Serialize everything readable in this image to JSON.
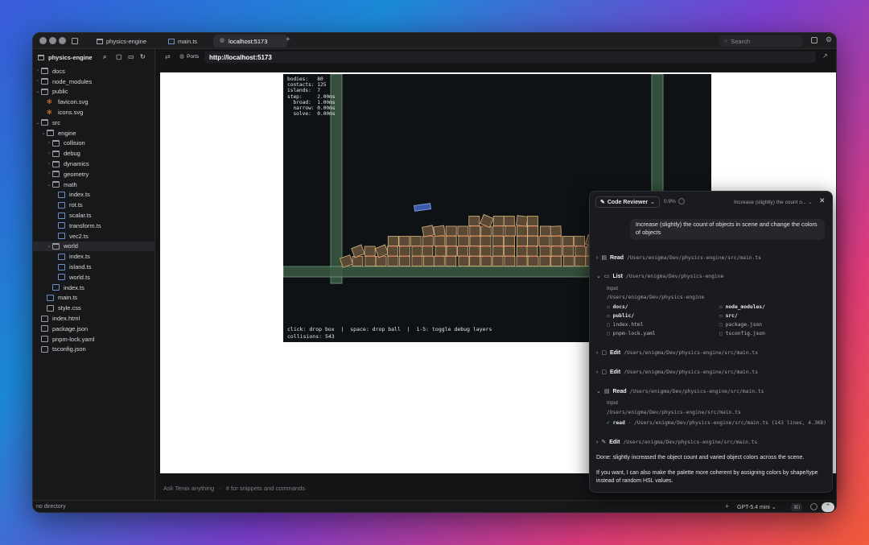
{
  "window": {
    "tabs": [
      {
        "label": "physics-engine"
      },
      {
        "label": "main.ts"
      },
      {
        "label": "localhost:5173"
      }
    ],
    "new_tab": "+",
    "search_placeholder": "Search"
  },
  "sidebar": {
    "project": "physics-engine",
    "tree": [
      {
        "label": "docs",
        "depth": 0,
        "kind": "dir",
        "open": false
      },
      {
        "label": "node_modules",
        "depth": 0,
        "kind": "dir",
        "open": false
      },
      {
        "label": "public",
        "depth": 0,
        "kind": "dir",
        "open": true
      },
      {
        "label": "favicon.svg",
        "depth": 1,
        "kind": "svg"
      },
      {
        "label": "icons.svg",
        "depth": 1,
        "kind": "svg"
      },
      {
        "label": "src",
        "depth": 0,
        "kind": "dir",
        "open": true
      },
      {
        "label": "engine",
        "depth": 1,
        "kind": "dir",
        "open": true
      },
      {
        "label": "collision",
        "depth": 2,
        "kind": "dir",
        "open": false
      },
      {
        "label": "debug",
        "depth": 2,
        "kind": "dir",
        "open": false
      },
      {
        "label": "dynamics",
        "depth": 2,
        "kind": "dir",
        "open": false
      },
      {
        "label": "geometry",
        "depth": 2,
        "kind": "dir",
        "open": false
      },
      {
        "label": "math",
        "depth": 2,
        "kind": "dir",
        "open": true
      },
      {
        "label": "index.ts",
        "depth": 3,
        "kind": "ts"
      },
      {
        "label": "rot.ts",
        "depth": 3,
        "kind": "ts"
      },
      {
        "label": "scalar.ts",
        "depth": 3,
        "kind": "ts"
      },
      {
        "label": "transform.ts",
        "depth": 3,
        "kind": "ts"
      },
      {
        "label": "vec2.ts",
        "depth": 3,
        "kind": "ts"
      },
      {
        "label": "world",
        "depth": 2,
        "kind": "dir",
        "open": true,
        "selected": true
      },
      {
        "label": "index.ts",
        "depth": 3,
        "kind": "ts"
      },
      {
        "label": "island.ts",
        "depth": 3,
        "kind": "ts"
      },
      {
        "label": "world.ts",
        "depth": 3,
        "kind": "ts"
      },
      {
        "label": "index.ts",
        "depth": 2,
        "kind": "ts"
      },
      {
        "label": "main.ts",
        "depth": 1,
        "kind": "ts"
      },
      {
        "label": "style.css",
        "depth": 1,
        "kind": "file"
      },
      {
        "label": "index.html",
        "depth": 0,
        "kind": "file"
      },
      {
        "label": "package.json",
        "depth": 0,
        "kind": "file"
      },
      {
        "label": "pnpm-lock.yaml",
        "depth": 0,
        "kind": "file"
      },
      {
        "label": "tsconfig.json",
        "depth": 0,
        "kind": "file"
      }
    ]
  },
  "browser": {
    "ports_label": "Ports",
    "url": "http://localhost:5173"
  },
  "sim": {
    "stats": "bodies:   80\ncontacts: 125\nislands:  7\nstep:     2.00ms\n  broad:  1.00ms\n  narrow: 0.00ms\n  solve:  0.00ms",
    "hint": "click: drop box  |  space: drop ball  |  1-5: toggle debug layers\ncollisions: 543"
  },
  "ask": {
    "placeholder": "Ask Terax anything",
    "hint": "# for snippets and commands"
  },
  "status": {
    "left": "no directory",
    "model": "GPT-5.4 mini",
    "shortcut": "⌘I"
  },
  "agent": {
    "title": "Code Reviewer",
    "percent": "0.9%",
    "thread": "Increase (slightly) the count o...",
    "user_message": "Increase (slightly) the count of objects in scene and change the colors of objects",
    "steps": [
      {
        "verb": "Read",
        "path": "/Users/enigma/Dev/physics-engine/src/main.ts"
      },
      {
        "verb": "List",
        "path": "/Users/enigma/Dev/physics-engine"
      },
      {
        "verb": "Edit",
        "path": "/Users/enigma/Dev/physics-engine/src/main.tx"
      },
      {
        "verb": "Edit",
        "path": "/Users/enigma/Dev/physics-engine/src/main.ts"
      },
      {
        "verb": "Read",
        "path": "/Users/enigma/Dev/physics-engine/src/main.ts"
      },
      {
        "verb": "Edit",
        "path": "/Users/enigma/Dev/physics-engine/src/main.ts"
      }
    ],
    "list_input_label": "Input",
    "list_input": "/Users/enigma/Dev/physics-engine",
    "list_items": [
      {
        "name": "docs/",
        "dir": true
      },
      {
        "name": "node_modules/",
        "dir": true
      },
      {
        "name": "public/",
        "dir": true
      },
      {
        "name": "src/",
        "dir": true
      },
      {
        "name": "index.html",
        "dir": false
      },
      {
        "name": "package.json",
        "dir": false
      },
      {
        "name": "pnpm-lock.yaml",
        "dir": false
      },
      {
        "name": "tsconfig.json",
        "dir": false
      }
    ],
    "read_input_label": "Input",
    "read_input": "/Users/enigma/Dev/physics-engine/src/main.ts",
    "read_result_verb": "read",
    "read_result": "· /Users/enigma/Dev/physics-engine/src/main.ts (143 lines, 4.3KB)",
    "done": "Done: slightly increased the object count and varied object colors across the scene.",
    "followup": "If you want, I can also make the palette more coherent by assigning colors by shape/type instead of random HSL values."
  }
}
